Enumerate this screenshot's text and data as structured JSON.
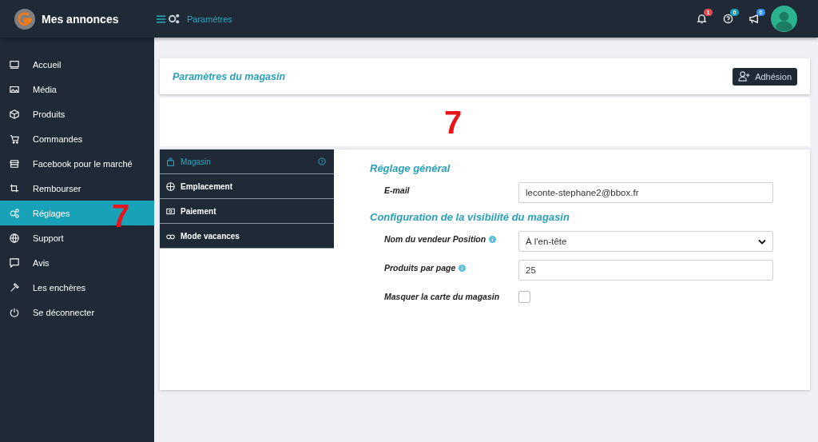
{
  "brand": {
    "title": "Mes annonces"
  },
  "topbar": {
    "breadcrumb": "Paramètres",
    "notifications": [
      {
        "count": "1",
        "color": "#e5484d"
      },
      {
        "count": "0",
        "color": "#17a2b8"
      },
      {
        "count": "0",
        "color": "#3b8eea"
      }
    ]
  },
  "sidebar": {
    "items": [
      {
        "label": "Accueil",
        "selected": false
      },
      {
        "label": "Média",
        "selected": false
      },
      {
        "label": "Produits",
        "selected": false
      },
      {
        "label": "Commandes",
        "selected": false
      },
      {
        "label": "Facebook pour le marché",
        "selected": false
      },
      {
        "label": "Rembourser",
        "selected": false
      },
      {
        "label": "Réglages",
        "selected": true
      },
      {
        "label": "Support",
        "selected": false
      },
      {
        "label": "Avis",
        "selected": false
      },
      {
        "label": "Les enchères",
        "selected": false
      },
      {
        "label": "Se déconnecter",
        "selected": false
      }
    ]
  },
  "header": {
    "title": "Paramètres du magasin",
    "button": "Adhésion"
  },
  "annotations": [
    "7",
    "7"
  ],
  "tabs": [
    {
      "label": "Magasin",
      "selected": true
    },
    {
      "label": "Emplacement",
      "selected": false
    },
    {
      "label": "Paiement",
      "selected": false
    },
    {
      "label": "Mode vacances",
      "selected": false
    }
  ],
  "sections": [
    {
      "title": "Réglage général",
      "fields": [
        {
          "kind": "text",
          "label": "E-mail",
          "help": false,
          "value": "leconte-stephane2@bbox.fr"
        }
      ]
    },
    {
      "title": "Configuration de la visibilité du magasin",
      "fields": [
        {
          "kind": "select",
          "label": "Nom du vendeur Position",
          "help": true,
          "value": "À l'en-tête"
        },
        {
          "kind": "text",
          "label": "Produits par page",
          "help": true,
          "value": "25"
        },
        {
          "kind": "checkbox",
          "label": "Masquer la carte du magasin",
          "help": false,
          "checked": false
        }
      ]
    }
  ]
}
